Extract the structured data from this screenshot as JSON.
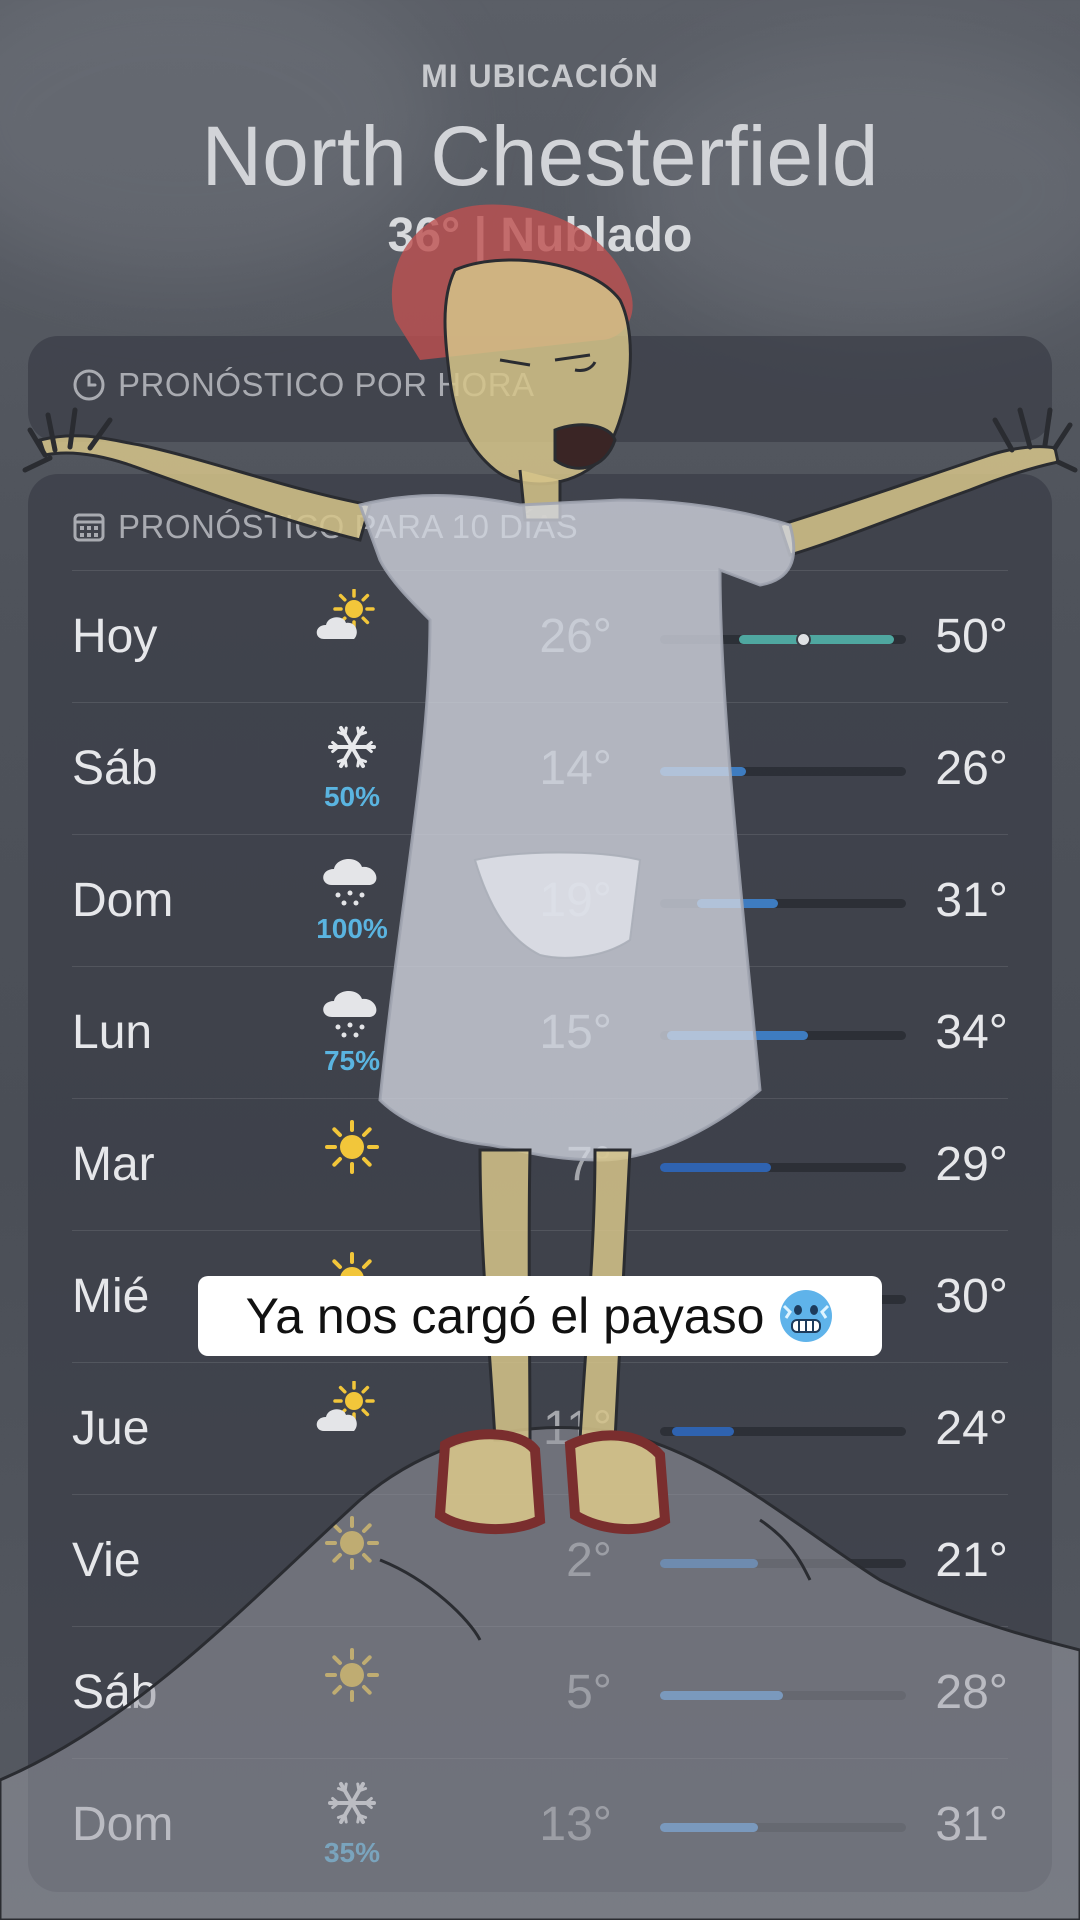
{
  "header": {
    "location_label": "MI UBICACIÓN",
    "city": "North Chesterfield",
    "current": "36°  |  Nublado"
  },
  "hourly": {
    "title": "PRONÓSTICO POR HORA"
  },
  "tenday": {
    "title": "PRONÓSTICO PARA 10 DÍAS",
    "days": [
      {
        "day": "Hoy",
        "icon": "partly-sunny-icon",
        "precip": "",
        "low": "26°",
        "high": "50°",
        "bar": [
          0.32,
          0.95
        ],
        "current": 0.58,
        "color": "teal"
      },
      {
        "day": "Sáb",
        "icon": "snowflake-icon",
        "precip": "50%",
        "low": "14°",
        "high": "26°",
        "bar": [
          0.0,
          0.35
        ],
        "color": "blue"
      },
      {
        "day": "Dom",
        "icon": "snow-cloud-icon",
        "precip": "100%",
        "low": "19°",
        "high": "31°",
        "bar": [
          0.15,
          0.48
        ],
        "color": "blue"
      },
      {
        "day": "Lun",
        "icon": "snow-cloud-icon",
        "precip": "75%",
        "low": "15°",
        "high": "34°",
        "bar": [
          0.03,
          0.6
        ],
        "color": "blue"
      },
      {
        "day": "Mar",
        "icon": "sun-icon",
        "precip": "",
        "low": "7°",
        "high": "29°",
        "bar": [
          0.0,
          0.45
        ],
        "color": "darkblue"
      },
      {
        "day": "Mié",
        "icon": "sun-icon",
        "precip": "",
        "low": "",
        "high": "30°",
        "bar": [
          0.0,
          0.0
        ],
        "color": "blue"
      },
      {
        "day": "Jue",
        "icon": "partly-sunny-icon",
        "precip": "",
        "low": "11°",
        "high": "24°",
        "bar": [
          0.05,
          0.3
        ],
        "color": "darkblue"
      },
      {
        "day": "Vie",
        "icon": "sun-icon",
        "precip": "",
        "low": "2°",
        "high": "21°",
        "bar": [
          0.0,
          0.4
        ],
        "color": "blue"
      },
      {
        "day": "Sáb",
        "icon": "sun-icon",
        "precip": "",
        "low": "5°",
        "high": "28°",
        "bar": [
          0.0,
          0.5
        ],
        "color": "lightblue"
      },
      {
        "day": "Dom",
        "icon": "snowflake-icon",
        "precip": "35%",
        "low": "13°",
        "high": "31°",
        "bar": [
          0.0,
          0.4
        ],
        "color": "lightblue"
      }
    ]
  },
  "caption": {
    "text": "Ya nos cargó el payaso",
    "emoji": "cold-face-emoji"
  },
  "colors": {
    "teal": "#4fa7a0",
    "blue": "#3e7cc0",
    "darkblue": "#2f63b0",
    "lightblue": "#5a9be0",
    "precip": "#5ab4e0"
  }
}
